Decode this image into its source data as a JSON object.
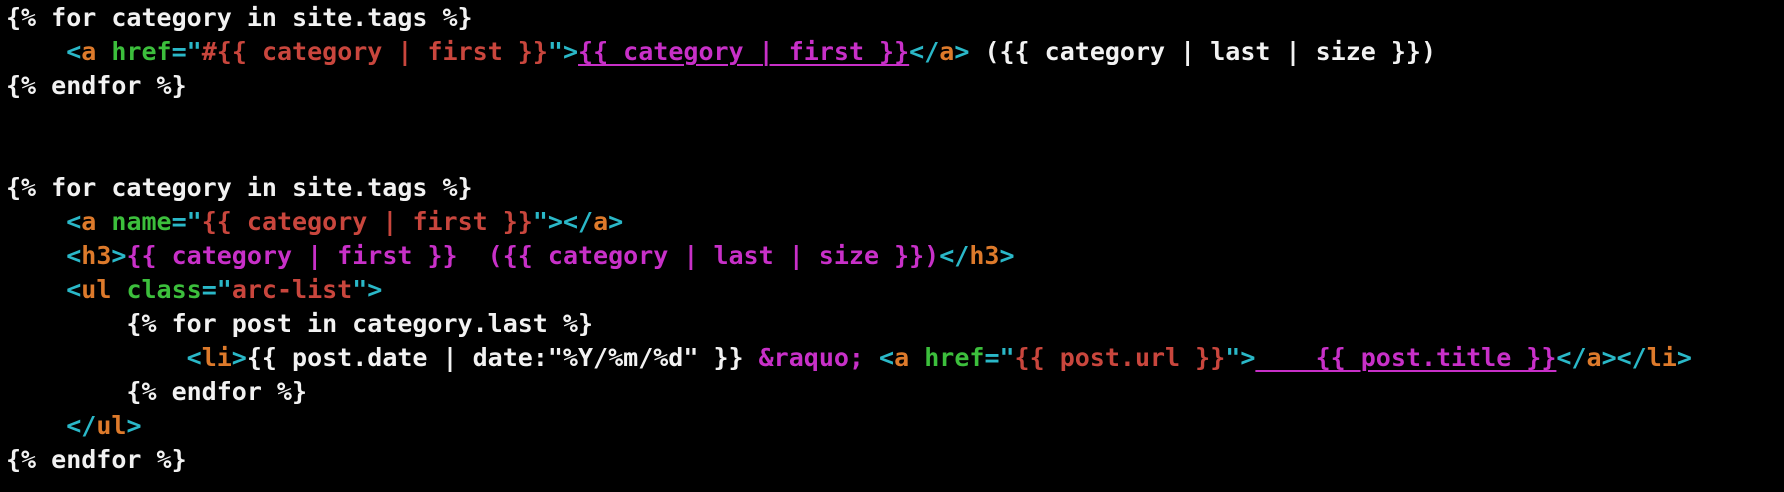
{
  "lines": [
    [
      {
        "text": "{% for category in site.tags %}",
        "color": "white"
      }
    ],
    [
      {
        "text": "    ",
        "color": "white"
      },
      {
        "text": "<",
        "color": "cyan"
      },
      {
        "text": "a",
        "color": "orange"
      },
      {
        "text": " ",
        "color": "white"
      },
      {
        "text": "href",
        "color": "green"
      },
      {
        "text": "=\"",
        "color": "cyan"
      },
      {
        "text": "#{{ category | first }}",
        "color": "red"
      },
      {
        "text": "\">",
        "color": "cyan"
      },
      {
        "text": "{{ category | first }}",
        "color": "magenta",
        "underline": true
      },
      {
        "text": "</",
        "color": "cyan"
      },
      {
        "text": "a",
        "color": "orange"
      },
      {
        "text": ">",
        "color": "cyan"
      },
      {
        "text": " ({{ category | last | size }})",
        "color": "white"
      }
    ],
    [
      {
        "text": "{% endfor %}",
        "color": "white"
      }
    ],
    [],
    [],
    [
      {
        "text": "{% for category in site.tags %}",
        "color": "white"
      }
    ],
    [
      {
        "text": "    ",
        "color": "white"
      },
      {
        "text": "<",
        "color": "cyan"
      },
      {
        "text": "a",
        "color": "orange"
      },
      {
        "text": " ",
        "color": "white"
      },
      {
        "text": "name",
        "color": "green"
      },
      {
        "text": "=\"",
        "color": "cyan"
      },
      {
        "text": "{{ category | first }}",
        "color": "red"
      },
      {
        "text": "\"></",
        "color": "cyan"
      },
      {
        "text": "a",
        "color": "orange"
      },
      {
        "text": ">",
        "color": "cyan"
      }
    ],
    [
      {
        "text": "    ",
        "color": "white"
      },
      {
        "text": "<",
        "color": "cyan"
      },
      {
        "text": "h3",
        "color": "orange"
      },
      {
        "text": ">",
        "color": "cyan"
      },
      {
        "text": "{{ category | first }}  ({{ category | last | size }})",
        "color": "magenta"
      },
      {
        "text": "</",
        "color": "cyan"
      },
      {
        "text": "h3",
        "color": "orange"
      },
      {
        "text": ">",
        "color": "cyan"
      }
    ],
    [
      {
        "text": "    ",
        "color": "white"
      },
      {
        "text": "<",
        "color": "cyan"
      },
      {
        "text": "ul",
        "color": "orange"
      },
      {
        "text": " ",
        "color": "white"
      },
      {
        "text": "class",
        "color": "green"
      },
      {
        "text": "=\"",
        "color": "cyan"
      },
      {
        "text": "arc-list",
        "color": "red"
      },
      {
        "text": "\">",
        "color": "cyan"
      }
    ],
    [
      {
        "text": "        {% for post in category.last %}",
        "color": "white"
      }
    ],
    [
      {
        "text": "            ",
        "color": "white"
      },
      {
        "text": "<",
        "color": "cyan"
      },
      {
        "text": "li",
        "color": "orange"
      },
      {
        "text": ">",
        "color": "cyan"
      },
      {
        "text": "{{ post.date | date:\"%Y/%m/%d\" }} ",
        "color": "white"
      },
      {
        "text": "&raquo;",
        "color": "magenta"
      },
      {
        "text": " ",
        "color": "white"
      },
      {
        "text": "<",
        "color": "cyan"
      },
      {
        "text": "a",
        "color": "orange"
      },
      {
        "text": " ",
        "color": "white"
      },
      {
        "text": "href",
        "color": "green"
      },
      {
        "text": "=\"",
        "color": "cyan"
      },
      {
        "text": "{{ post.url }}",
        "color": "red"
      },
      {
        "text": "\">",
        "color": "cyan"
      },
      {
        "text": "    {{ post.title }}",
        "color": "magenta",
        "underline": true
      },
      {
        "text": "</",
        "color": "cyan"
      },
      {
        "text": "a",
        "color": "orange"
      },
      {
        "text": "></",
        "color": "cyan"
      },
      {
        "text": "li",
        "color": "orange"
      },
      {
        "text": ">",
        "color": "cyan"
      }
    ],
    [
      {
        "text": "        {% endfor %}",
        "color": "white"
      }
    ],
    [
      {
        "text": "    ",
        "color": "white"
      },
      {
        "text": "</",
        "color": "cyan"
      },
      {
        "text": "ul",
        "color": "orange"
      },
      {
        "text": ">",
        "color": "cyan"
      }
    ],
    [
      {
        "text": "{% endfor %}",
        "color": "white"
      }
    ]
  ],
  "colors": {
    "background": "#000000",
    "white": "#f2f2f2",
    "cyan": "#2ab8c8",
    "orange": "#dd7a2b",
    "green": "#3cbf3c",
    "red": "#c9463d",
    "magenta": "#c830c8"
  }
}
